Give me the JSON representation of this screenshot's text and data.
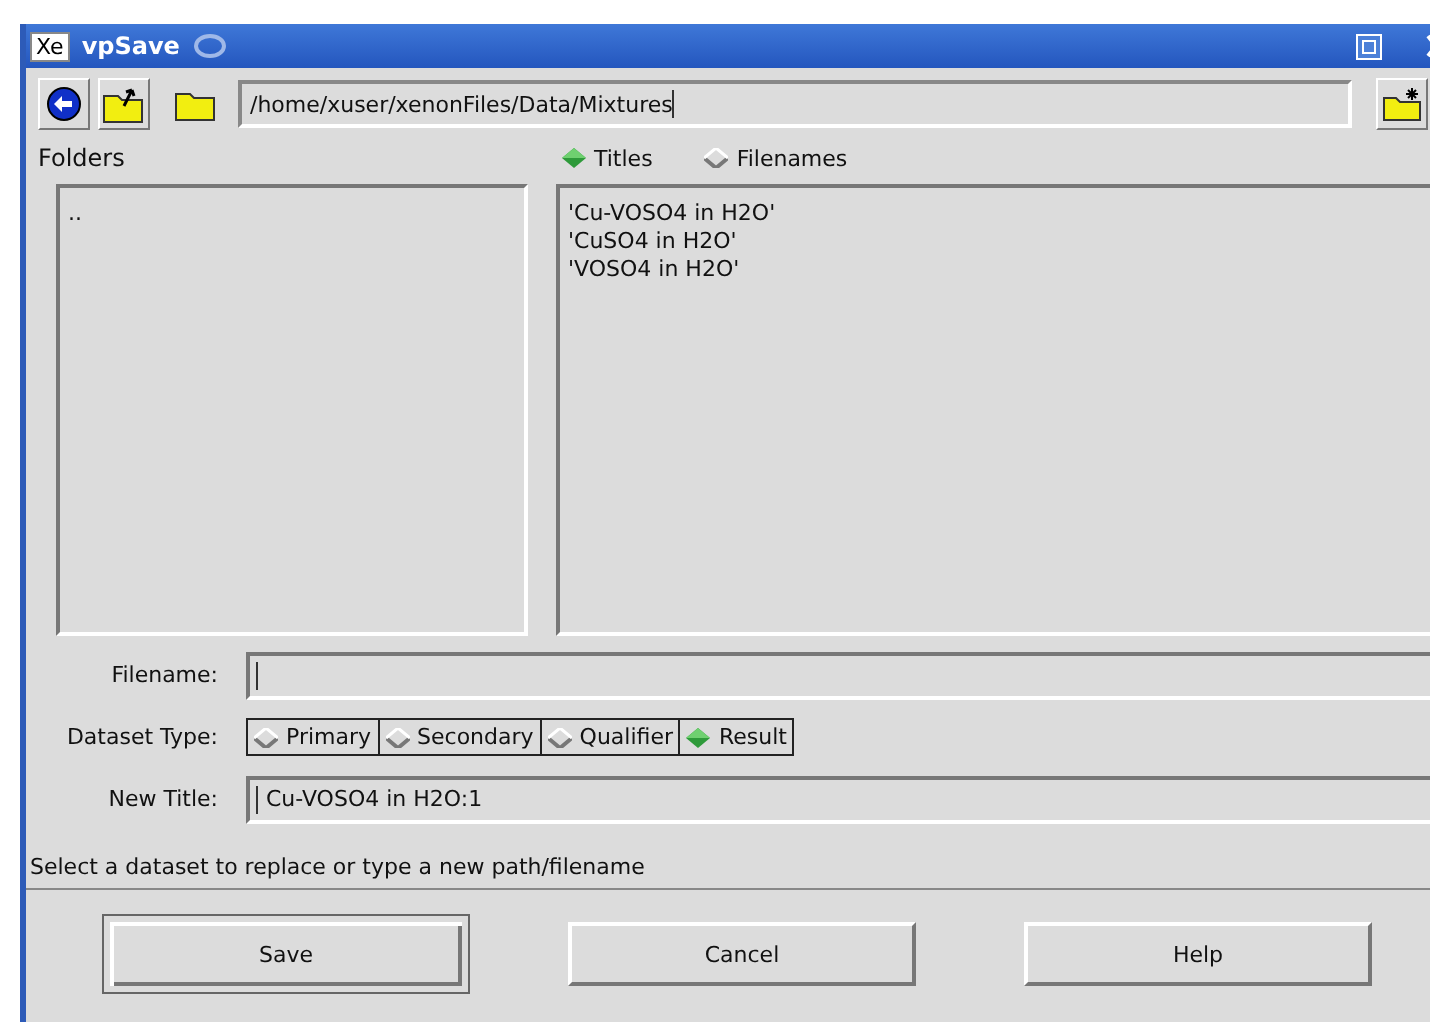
{
  "window": {
    "logo": "Xe",
    "title": "vpSave"
  },
  "toolbar": {
    "path": "/home/xuser/xenonFiles/Data/Mixtures"
  },
  "folders": {
    "label": "Folders",
    "items": [
      ".."
    ]
  },
  "view_mode": [
    {
      "label": "Titles",
      "selected": true
    },
    {
      "label": "Filenames",
      "selected": false
    }
  ],
  "files": {
    "items": [
      "'Cu-VOSO4 in H2O'",
      "'CuSO4 in H2O'",
      "'VOSO4 in H2O'"
    ]
  },
  "filename": {
    "label": "Filename:"
  },
  "dataset_type": {
    "label": "Dataset Type:",
    "options": [
      {
        "label": "Primary",
        "selected": false
      },
      {
        "label": "Secondary",
        "selected": false
      },
      {
        "label": "Qualifier",
        "selected": false
      },
      {
        "label": "Result",
        "selected": true
      }
    ]
  },
  "new_title": {
    "label": "New Title:",
    "value": "Cu-VOSO4 in H2O:1"
  },
  "status": "Select a dataset to replace or type a new path/filename",
  "buttons": [
    {
      "label": "Save",
      "default": true
    },
    {
      "label": "Cancel",
      "default": false
    },
    {
      "label": "Help",
      "default": false
    }
  ]
}
